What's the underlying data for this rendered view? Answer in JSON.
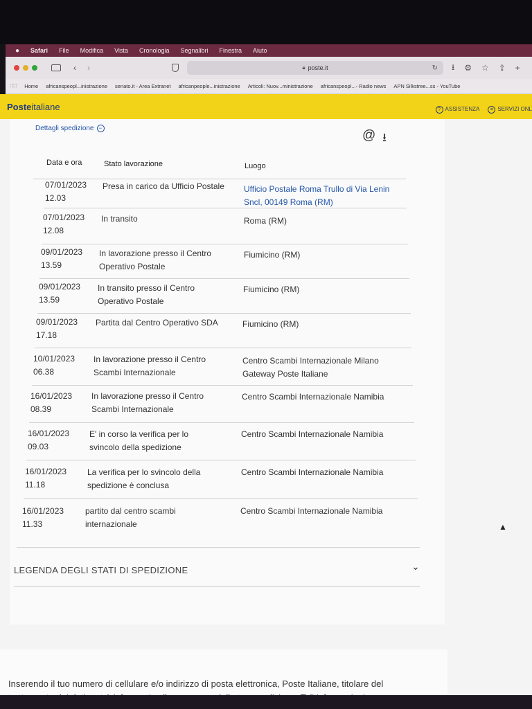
{
  "menubar": {
    "apple": "",
    "app": "Safari",
    "items": [
      "File",
      "Modifica",
      "Vista",
      "Cronologia",
      "Segnalibri",
      "Finestra",
      "Aiuto"
    ]
  },
  "toolbar": {
    "url": "poste.it"
  },
  "bookmarks": [
    "Home",
    "africanspeopl...inistrazione",
    "senato.it - Area Extranet",
    "africanpeople...inistrazione",
    "Articoli: Nuov...ministrazione",
    "africanspeopl...- Radio news",
    "APN Silkstree...ss - YouTube"
  ],
  "header": {
    "logo_bold": "Poste",
    "logo_rest": "italiane",
    "assistenza": "ASSISTENZA",
    "servizi": "SERVIZI ONL"
  },
  "details": {
    "link_label": "Dettagli spedizione",
    "col_date": "Data e ora",
    "col_status": "Stato lavorazione",
    "col_place": "Luogo"
  },
  "rows": [
    {
      "date": "07/01/2023",
      "time": "12.03",
      "status1": "Presa in carico da Ufficio Postale",
      "status2": "",
      "place1": "Ufficio Postale Roma Trullo di Via Lenin",
      "place2": "Sncl, 00149 Roma (RM)"
    },
    {
      "date": "07/01/2023",
      "time": "12.08",
      "status1": "In transito",
      "status2": "",
      "place1": "Roma (RM)",
      "place2": ""
    },
    {
      "date": "09/01/2023",
      "time": "13.59",
      "status1": "In lavorazione presso il Centro",
      "status2": "Operativo Postale",
      "place1": "Fiumicino (RM)",
      "place2": ""
    },
    {
      "date": "09/01/2023",
      "time": "13.59",
      "status1": "In transito presso il Centro",
      "status2": "Operativo Postale",
      "place1": "Fiumicino (RM)",
      "place2": ""
    },
    {
      "date": "09/01/2023",
      "time": "17.18",
      "status1": "Partita dal Centro Operativo SDA",
      "status2": "",
      "place1": "Fiumicino (RM)",
      "place2": ""
    },
    {
      "date": "10/01/2023",
      "time": "06.38",
      "status1": "In lavorazione presso il Centro",
      "status2": "Scambi Internazionale",
      "place1": "Centro Scambi Internazionale Milano",
      "place2": "Gateway Poste Italiane"
    },
    {
      "date": "16/01/2023",
      "time": "08.39",
      "status1": "In lavorazione presso il Centro",
      "status2": "Scambi Internazionale",
      "place1": "Centro Scambi Internazionale Namibia",
      "place2": ""
    },
    {
      "date": "16/01/2023",
      "time": "09.03",
      "status1": "E' in corso la verifica per lo",
      "status2": "svincolo della spedizione",
      "place1": "Centro Scambi Internazionale Namibia",
      "place2": ""
    },
    {
      "date": "16/01/2023",
      "time": "11.18",
      "status1": "La verifica per lo svincolo della",
      "status2": "spedizione è conclusa",
      "place1": "Centro Scambi Internazionale Namibia",
      "place2": ""
    },
    {
      "date": "16/01/2023",
      "time": "11.33",
      "status1": "partito dal centro scambi",
      "status2": "internazionale",
      "place1": "Centro Scambi Internazionale Namibia",
      "place2": ""
    }
  ],
  "legend": {
    "title": "LEGENDA DEGLI STATI DI SPEDIZIONE"
  },
  "notice": {
    "line1": "Inserendo il tuo numero di cellulare e/o indirizzo di posta elettronica, Poste Italiane, titolare del",
    "line2": "trattamento dei dati, potrà informarti sulla consegna della tua spedizione. Tali informazioni"
  }
}
